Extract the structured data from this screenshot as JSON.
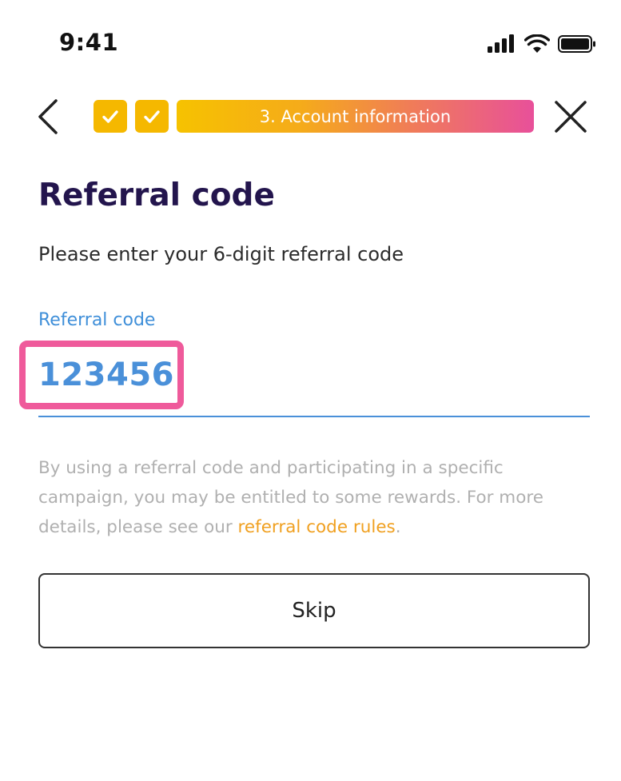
{
  "status_bar": {
    "time": "9:41",
    "icons": [
      "cellular-signal-icon",
      "wifi-icon",
      "battery-icon"
    ]
  },
  "nav": {
    "back_icon": "chevron-left-icon",
    "close_icon": "close-icon",
    "steps": [
      {
        "state": "completed",
        "icon": "checkmark-icon"
      },
      {
        "state": "completed",
        "icon": "checkmark-icon"
      },
      {
        "state": "current",
        "label": "3. Account information"
      }
    ]
  },
  "page": {
    "title": "Referral code",
    "subtitle": "Please enter your 6-digit referral code"
  },
  "referral_field": {
    "label": "Referral code",
    "value": "123456"
  },
  "disclaimer": {
    "text": "By using a referral code and participating in a specific campaign, you may be entitled to some rewards. For more details, please see our ",
    "link_text": "referral code rules",
    "suffix": "."
  },
  "skip_button": {
    "label": "Skip"
  },
  "colors": {
    "title": "#23154d",
    "accent_blue": "#4a90d9",
    "step_yellow": "#f5b800",
    "gradient_end": "#e8509a",
    "highlight_pink": "#ef5a9b",
    "link_orange": "#f0a020",
    "muted_text": "#b0b0b0"
  }
}
